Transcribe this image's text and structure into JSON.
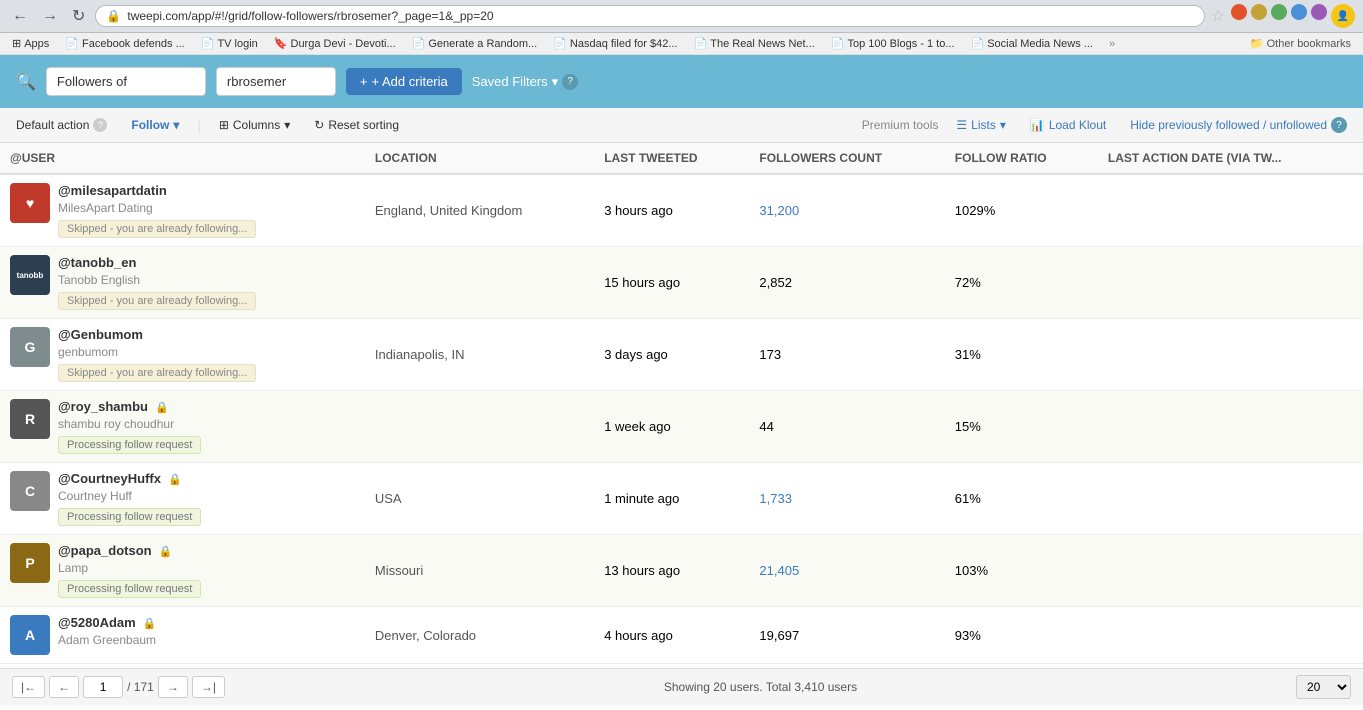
{
  "browser": {
    "url": "tweepi.com/app/#!/grid/follow-followers/rbrosemer?_page=1&_pp=20",
    "bookmarks": [
      {
        "label": "Apps",
        "icon": "⊞"
      },
      {
        "label": "Facebook defends ...",
        "icon": "📄",
        "color": "red"
      },
      {
        "label": "TV login",
        "icon": "📄",
        "color": "red"
      },
      {
        "label": "Durga Devi - Devoti...",
        "icon": "🔖"
      },
      {
        "label": "Generate a Random...",
        "icon": "📄",
        "color": "red"
      },
      {
        "label": "Nasdaq filed for $42...",
        "icon": "📄"
      },
      {
        "label": "The Real News Net...",
        "icon": "📄"
      },
      {
        "label": "Top 100 Blogs - 1 to...",
        "icon": "📄",
        "color": "green"
      },
      {
        "label": "Social Media News ...",
        "icon": "📄",
        "color": "blue"
      },
      {
        "label": "Other bookmarks",
        "icon": "📁"
      }
    ]
  },
  "filter": {
    "criterion_label": "Followers of",
    "criterion_value": "rbrosemer",
    "add_criteria_label": "+ Add criteria",
    "saved_filters_label": "Saved Filters"
  },
  "toolbar": {
    "default_action_label": "Default action",
    "follow_label": "Follow",
    "columns_label": "Columns",
    "reset_sorting_label": "Reset sorting",
    "premium_label": "Premium tools",
    "lists_label": "Lists",
    "load_klout_label": "Load Klout",
    "hide_followed_label": "Hide previously followed / unfollowed"
  },
  "table": {
    "columns": [
      "@USER",
      "LOCATION",
      "LAST TWEETED",
      "FOLLOWERS COUNT",
      "FOLLOW RATIO",
      "LAST ACTION DATE (VIA TW..."
    ],
    "rows": [
      {
        "handle": "@milesapartdatin",
        "name": "MilesApart Dating",
        "avatar_text": "♥",
        "avatar_color": "#c0392b",
        "location": "England, United Kingdom",
        "last_tweeted": "3 hours ago",
        "followers_count": "31,200",
        "follow_ratio": "1029%",
        "status": "Skipped - you are already following...",
        "status_type": "skipped",
        "is_private": false,
        "follower_link": true
      },
      {
        "handle": "@tanobb_en",
        "name": "Tanobb English",
        "avatar_text": "tanobb",
        "avatar_color": "#2c3e50",
        "location": "",
        "last_tweeted": "15 hours ago",
        "followers_count": "2,852",
        "follow_ratio": "72%",
        "status": "Skipped - you are already following...",
        "status_type": "skipped",
        "is_private": false,
        "follower_link": false
      },
      {
        "handle": "@Genbumom",
        "name": "genbumom",
        "avatar_text": "G",
        "avatar_color": "#7f8c8d",
        "location": "Indianapolis, IN",
        "last_tweeted": "3 days ago",
        "followers_count": "173",
        "follow_ratio": "31%",
        "status": "Skipped - you are already following...",
        "status_type": "skipped",
        "is_private": false,
        "follower_link": false
      },
      {
        "handle": "@roy_shambu",
        "name": "shambu roy choudhur",
        "avatar_text": "R",
        "avatar_color": "#555",
        "location": "",
        "last_tweeted": "1 week ago",
        "followers_count": "44",
        "follow_ratio": "15%",
        "status": "Processing follow request",
        "status_type": "processing",
        "is_private": true,
        "follower_link": false
      },
      {
        "handle": "@CourtneyHuffx",
        "name": "Courtney Huff",
        "avatar_text": "C",
        "avatar_color": "#888",
        "location": "USA",
        "last_tweeted": "1 minute ago",
        "followers_count": "1,733",
        "follow_ratio": "61%",
        "status": "Processing follow request",
        "status_type": "processing",
        "is_private": true,
        "follower_link": true
      },
      {
        "handle": "@papa_dotson",
        "name": "Lamp",
        "avatar_text": "P",
        "avatar_color": "#8B6914",
        "location": "Missouri",
        "last_tweeted": "13 hours ago",
        "followers_count": "21,405",
        "follow_ratio": "103%",
        "status": "Processing follow request",
        "status_type": "processing",
        "is_private": true,
        "follower_link": true
      },
      {
        "handle": "@5280Adam",
        "name": "Adam Greenbaum",
        "avatar_text": "A",
        "avatar_color": "#3a7abf",
        "location": "Denver, Colorado",
        "last_tweeted": "4 hours ago",
        "followers_count": "19,697",
        "follow_ratio": "93%",
        "status": "",
        "status_type": "none",
        "is_private": true,
        "follower_link": false
      }
    ]
  },
  "footer": {
    "page_current": "1",
    "page_total": "/ 171",
    "showing_text": "Showing 20 users. Total 3,410 users",
    "per_page_value": "20"
  }
}
